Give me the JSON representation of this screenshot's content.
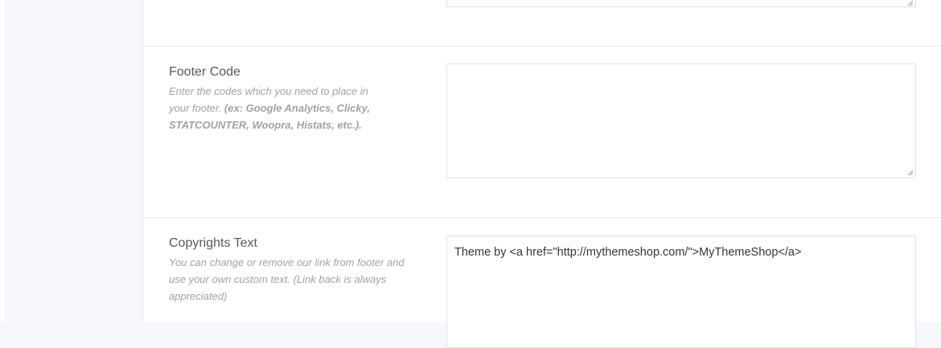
{
  "sections": {
    "header_code": {
      "value": ""
    },
    "footer_code": {
      "title": "Footer Code",
      "description_plain": "Enter the codes which you need to place in your footer.",
      "description_bold": "(ex: Google Analytics, Clicky, STATCOUNTER, Woopra, Histats, etc.).",
      "value": ""
    },
    "copyrights_text": {
      "title": "Copyrights Text",
      "description": "You can change or remove our link from footer and use your own custom text. (Link back is always appreciated)",
      "value": "Theme by <a href=\"http://mythemeshop.com/\">MyThemeShop</a>"
    }
  },
  "colors": {
    "sidebar_bg": "#f5f7fb",
    "content_bg": "#ffffff",
    "title_text": "#555a5f",
    "desc_text": "#9ea3a8",
    "border": "#dfe2e6"
  },
  "icons": {
    "resize_grip": "resize-grip-icon"
  }
}
